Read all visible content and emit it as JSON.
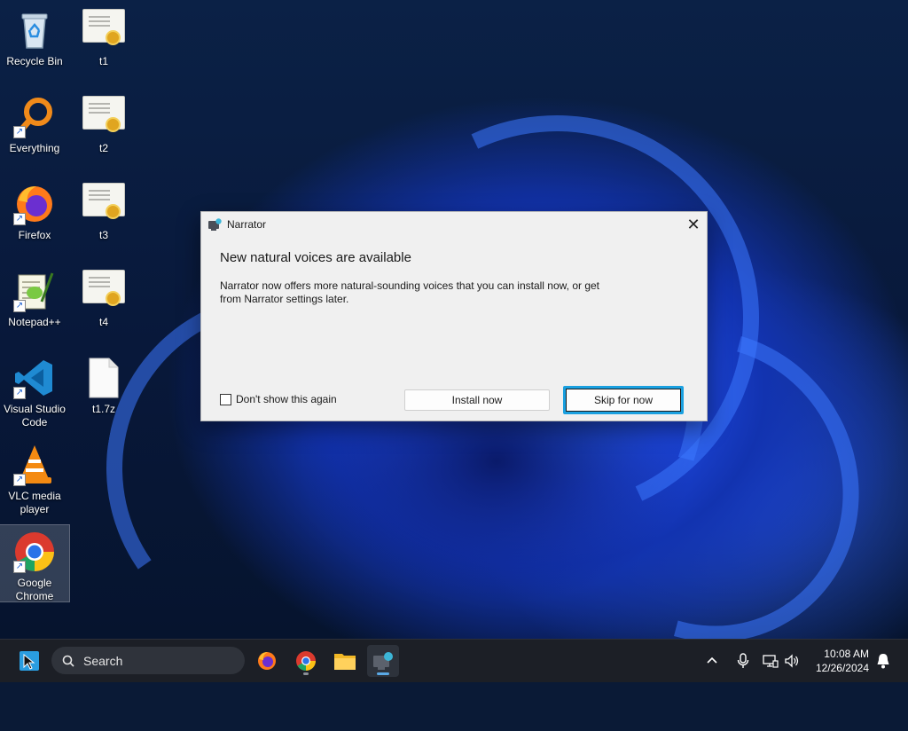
{
  "desktop": {
    "icons": [
      {
        "label": "Recycle Bin",
        "icon": "recycle-bin-icon"
      },
      {
        "label": "t1",
        "icon": "certificate-file-icon"
      },
      {
        "label": "Everything",
        "icon": "everything-search-icon"
      },
      {
        "label": "t2",
        "icon": "certificate-file-icon"
      },
      {
        "label": "Firefox",
        "icon": "firefox-icon"
      },
      {
        "label": "t3",
        "icon": "certificate-file-icon"
      },
      {
        "label": "Notepad++",
        "icon": "notepad-plus-plus-icon"
      },
      {
        "label": "t4",
        "icon": "certificate-file-icon"
      },
      {
        "label": "Visual Studio Code",
        "icon": "vscode-icon"
      },
      {
        "label": "t1.7z",
        "icon": "blank-file-icon"
      },
      {
        "label": "VLC media player",
        "icon": "vlc-icon"
      },
      {
        "label": "Google Chrome",
        "icon": "chrome-icon"
      }
    ]
  },
  "dialog": {
    "title": "Narrator",
    "close_glyph": "✕",
    "heading": "New natural voices are available",
    "body": "Narrator now offers more natural-sounding voices that you can install now, or get from Narrator settings later.",
    "checkbox_label": "Don't show this again",
    "checkbox_checked": false,
    "install_label": "Install now",
    "skip_label": "Skip for now"
  },
  "taskbar": {
    "search_placeholder": "Search",
    "apps": [
      "firefox-icon",
      "chrome-icon",
      "file-explorer-icon",
      "narrator-icon"
    ],
    "tray": {
      "time": "10:08 AM",
      "date": "12/26/2024"
    }
  },
  "colors": {
    "focus_ring": "#1aa0e0",
    "taskbar_bg": "#1c1f26",
    "dialog_bg": "#f0f0f0"
  }
}
